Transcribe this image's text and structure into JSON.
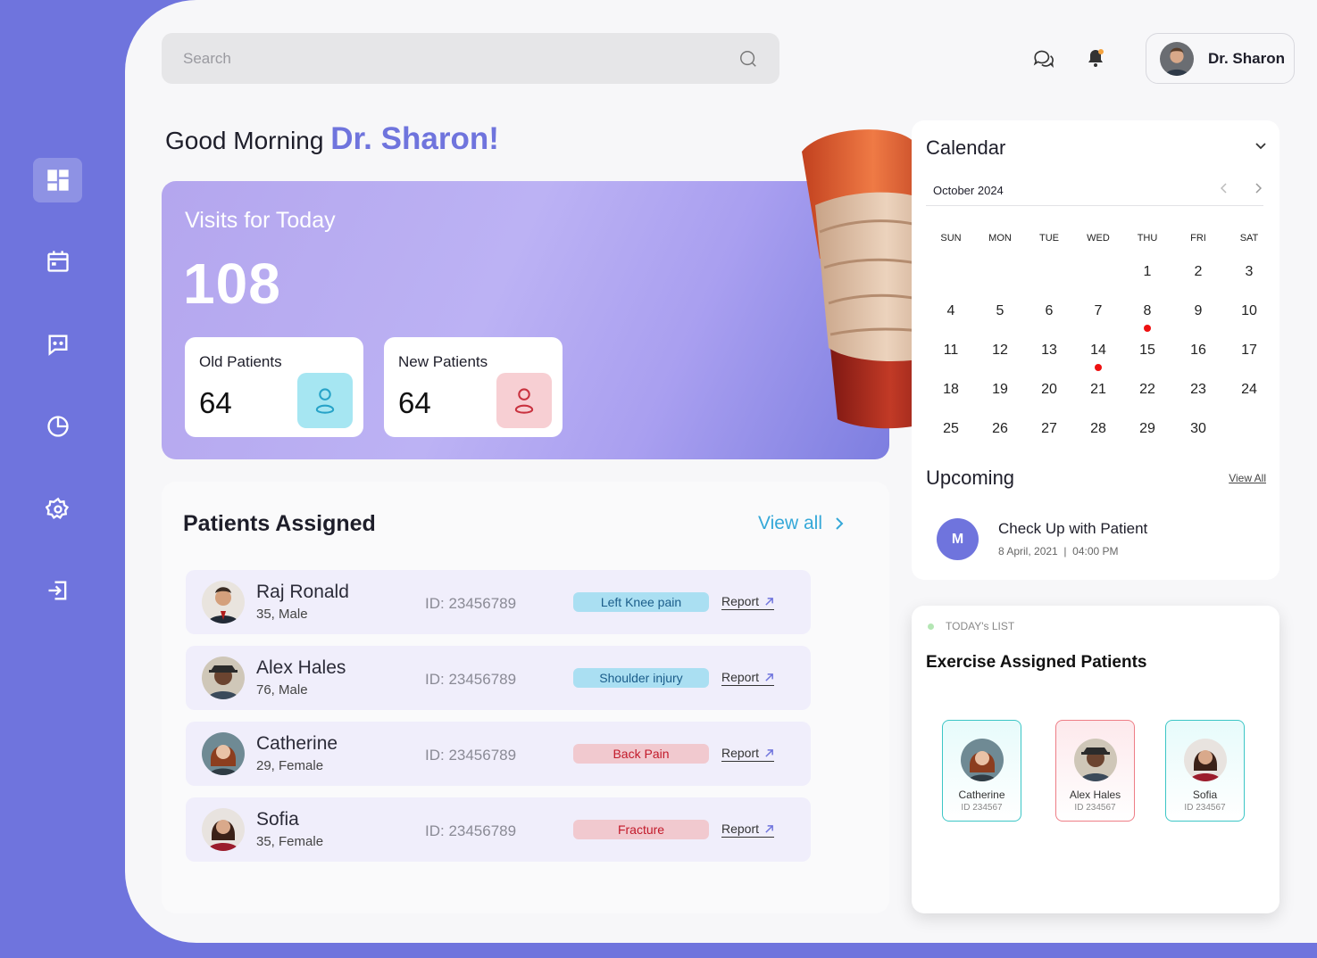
{
  "search": {
    "placeholder": "Search"
  },
  "header": {
    "user_name": "Dr. Sharon"
  },
  "greeting": {
    "prefix": "Good Morning",
    "name": "Dr. Sharon!"
  },
  "visits": {
    "title": "Visits for Today",
    "count": "108",
    "old": {
      "label": "Old Patients",
      "value": "64"
    },
    "new": {
      "label": "New Patients",
      "value": "64"
    }
  },
  "assigned": {
    "title": "Patients Assigned",
    "view_all": "View all",
    "patients": [
      {
        "name": "Raj Ronald",
        "meta": "35, Male",
        "id": "ID: 23456789",
        "condition": "Left Knee pain",
        "report": "Report"
      },
      {
        "name": "Alex Hales",
        "meta": "76, Male",
        "id": "ID: 23456789",
        "condition": "Shoulder injury",
        "report": "Report"
      },
      {
        "name": "Catherine",
        "meta": "29, Female",
        "id": "ID: 23456789",
        "condition": "Back Pain",
        "report": "Report"
      },
      {
        "name": "Sofia",
        "meta": "35, Female",
        "id": "ID: 23456789",
        "condition": "Fracture",
        "report": "Report"
      }
    ]
  },
  "calendar": {
    "title": "Calendar",
    "month": "October 2024",
    "weekdays": [
      "SUN",
      "MON",
      "TUE",
      "WED",
      "THU",
      "FRI",
      "SAT"
    ],
    "days": [
      "1",
      "2",
      "3",
      "4",
      "5",
      "6",
      "7",
      "8",
      "9",
      "10",
      "11",
      "12",
      "13",
      "14",
      "15",
      "16",
      "17",
      "18",
      "19",
      "20",
      "21",
      "22",
      "23",
      "24",
      "25",
      "26",
      "27",
      "28",
      "29",
      "30"
    ],
    "marked_days": [
      "8",
      "14"
    ]
  },
  "upcoming": {
    "title": "Upcoming",
    "view_all": "View All",
    "event": {
      "initial": "M",
      "title": "Check Up with Patient",
      "date": "8 April, 2021",
      "time": "04:00 PM"
    }
  },
  "today": {
    "label": "TODAY's LIST",
    "title": "Exercise Assigned Patients",
    "cards": [
      {
        "name": "Catherine",
        "id": "ID 234567"
      },
      {
        "name": "Alex Hales",
        "id": "ID 234567"
      },
      {
        "name": "Sofia",
        "id": "ID 234567"
      }
    ]
  },
  "colors": {
    "accent": "#6f74dd",
    "teal": "#35a8d8",
    "marker": "#ee1111"
  }
}
